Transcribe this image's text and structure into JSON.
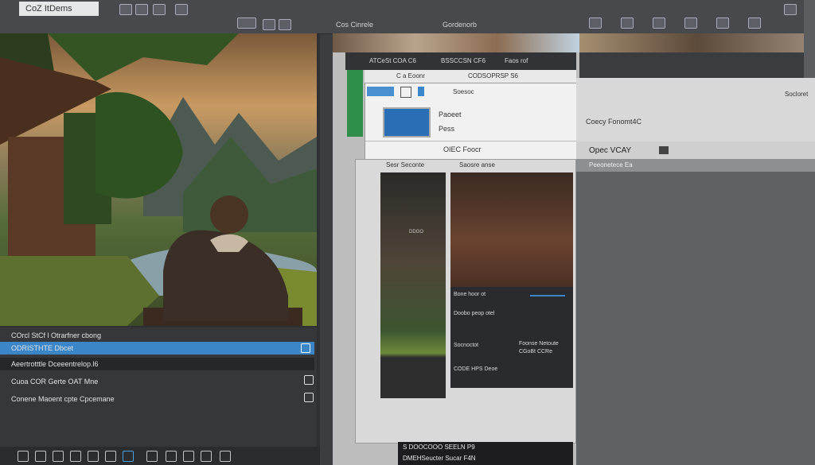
{
  "window": {
    "title": "CoZ ItDems"
  },
  "top_toolbar": {
    "label_a": "Cos Cinrele",
    "label_b": "Gordenorb"
  },
  "layers_panel": {
    "rows": [
      {
        "label": "COrcl StCf l Otrarfner cbong"
      },
      {
        "label": "ODRISTHTE Dbcet"
      },
      {
        "label": "Aeertrotttle Dceeentrelop.l6"
      },
      {
        "label": "Cuoa COR Gerte OAT Mne"
      },
      {
        "label": "Conene Maoent cpte Cpcemane"
      }
    ]
  },
  "dialog": {
    "tab1": "ATCeSt COA C6",
    "tab2": "BSSCCSN CF6",
    "tab3": "Faos rof",
    "tools_label_1": "C a Eoonr",
    "tools_label_2": "CODSOPRSP S6",
    "menu_item_1": "Paoeet",
    "menu_item_2": "Pess",
    "menu_bottom": "OIEC Foocr",
    "menu_top_right": "Soesoc",
    "strip_left": "Sesr Seconte",
    "strip_right": "Saosre anse",
    "thumb_label": "DDGO",
    "pane_line1": "Bone hoor ot",
    "pane_line2": "Doobo peop otel",
    "pane_line3": "Socnoctot",
    "pane_line4": "Foonse Netoute",
    "pane_line5": "CGoBt CCRe",
    "pane_line6": "CODE HPS Deoe",
    "bottom_line1": "S DOOCOOO SEELN P9",
    "bottom_line2": "DMEHSeucter Sucar F4N"
  },
  "right_panel": {
    "head_label": "Coecy Fonomt4C",
    "head_corner": "Socloret",
    "open_label": "Opec VCAY",
    "row2_label": "Peeonetece Ea"
  }
}
